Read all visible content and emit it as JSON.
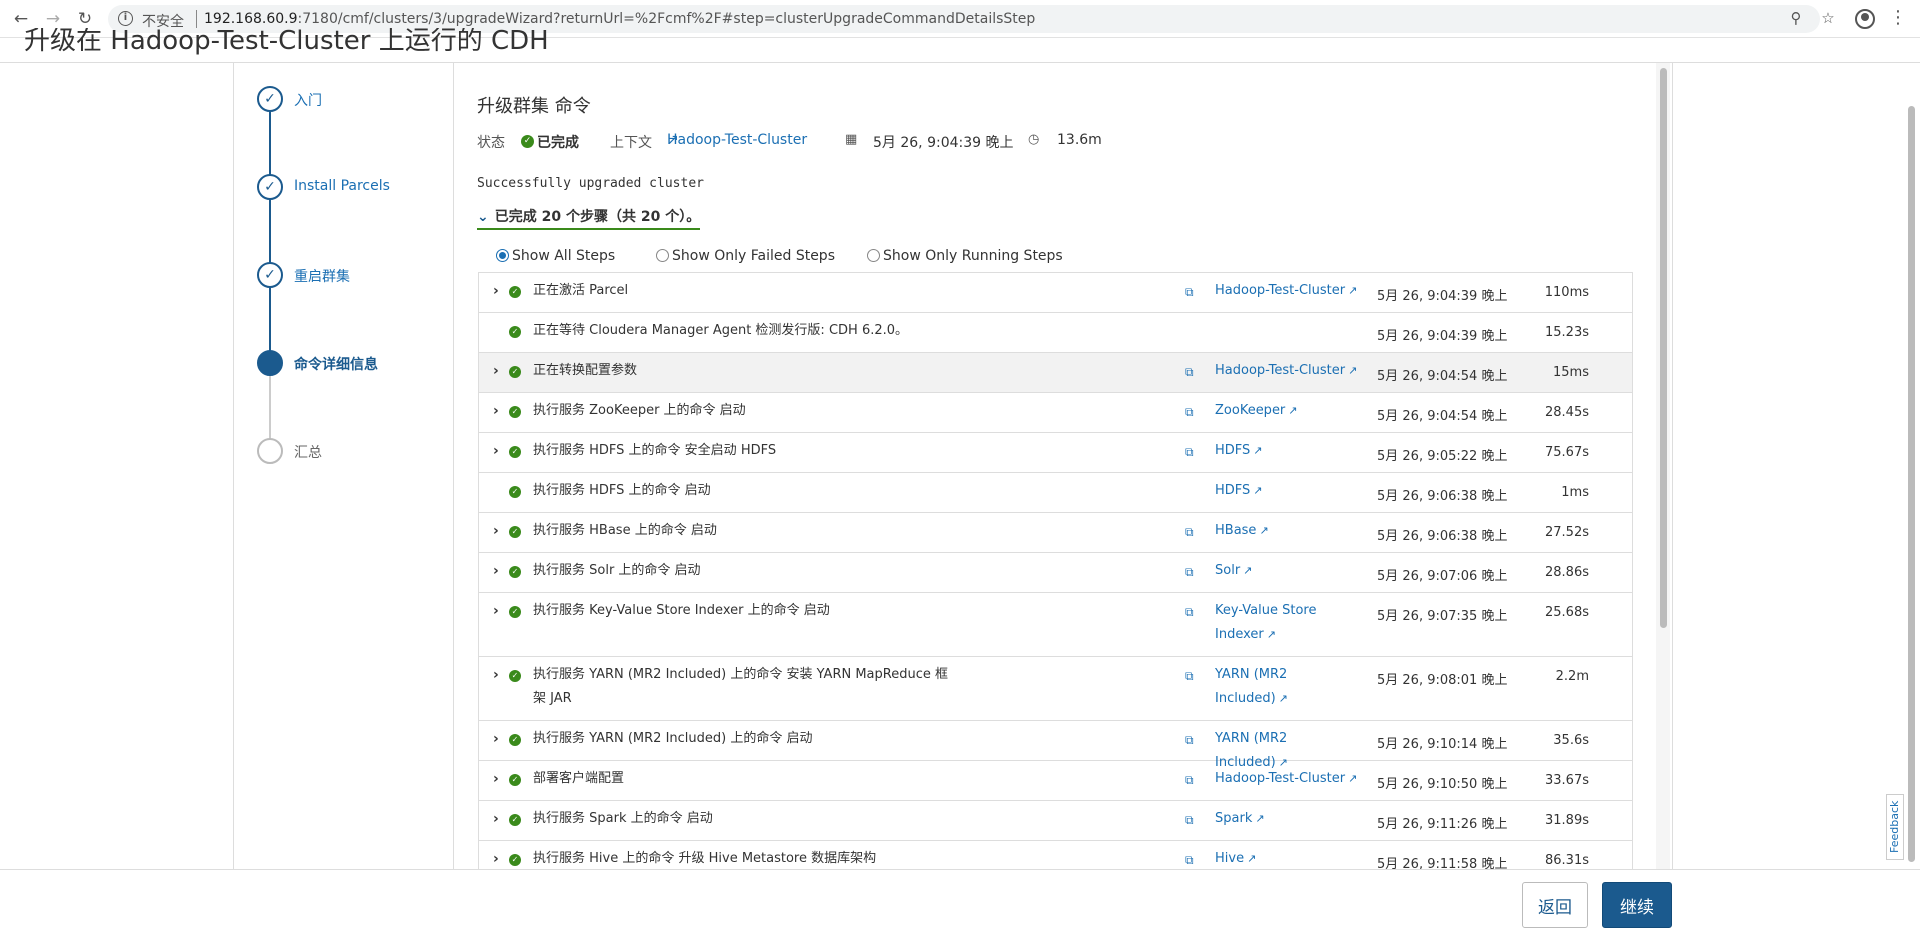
{
  "browser": {
    "insecure_label": "不安全",
    "url_host": "192.168.60.9",
    "url_path": ":7180/cmf/clusters/3/upgradeWizard?returnUrl=%2Fcmf%2F#step=clusterUpgradeCommandDetailsStep"
  },
  "page": {
    "title": "升级在 Hadoop-Test-Cluster 上运行的 CDH"
  },
  "wizard": {
    "steps": [
      {
        "label": "入门",
        "state": "done"
      },
      {
        "label": "Install Parcels",
        "state": "done"
      },
      {
        "label": "重启群集",
        "state": "done"
      },
      {
        "label": "命令详细信息",
        "state": "active"
      },
      {
        "label": "汇总",
        "state": "pending"
      }
    ]
  },
  "command": {
    "title": "升级群集 命令",
    "status_label": "状态",
    "status_value": "已完成",
    "context_label": "上下文",
    "context_value": "Hadoop-Test-Cluster",
    "start_time": "5月 26, 9:04:39 晚上",
    "duration": "13.6m",
    "result_message": "Successfully upgraded cluster",
    "steps_summary": "已完成 20 个步骤（共 20 个）。"
  },
  "filters": {
    "all": "Show All Steps",
    "failed": "Show Only Failed Steps",
    "running": "Show Only Running Steps",
    "selected": "all"
  },
  "steps": [
    {
      "name": "正在激活 Parcel",
      "ctx": "Hadoop-Test-Cluster",
      "time": "5月 26, 9:04:39 晚上",
      "dur": "110ms",
      "expandable": true
    },
    {
      "name": "正在等待 Cloudera Manager Agent 检测发行版: CDH 6.2.0。",
      "ctx": "",
      "time": "5月 26, 9:04:39 晚上",
      "dur": "15.23s",
      "expandable": false
    },
    {
      "name": "正在转换配置参数",
      "ctx": "Hadoop-Test-Cluster",
      "time": "5月 26, 9:04:54 晚上",
      "dur": "15ms",
      "expandable": true
    },
    {
      "name": "执行服务 ZooKeeper 上的命令 启动",
      "ctx": "ZooKeeper",
      "time": "5月 26, 9:04:54 晚上",
      "dur": "28.45s",
      "expandable": true
    },
    {
      "name": "执行服务 HDFS 上的命令 安全启动 HDFS",
      "ctx": "HDFS",
      "time": "5月 26, 9:05:22 晚上",
      "dur": "75.67s",
      "expandable": true
    },
    {
      "name": "执行服务 HDFS 上的命令 启动",
      "ctx": "HDFS",
      "time": "5月 26, 9:06:38 晚上",
      "dur": "1ms",
      "expandable": false
    },
    {
      "name": "执行服务 HBase 上的命令 启动",
      "ctx": "HBase",
      "time": "5月 26, 9:06:38 晚上",
      "dur": "27.52s",
      "expandable": true
    },
    {
      "name": "执行服务 Solr 上的命令 启动",
      "ctx": "Solr",
      "time": "5月 26, 9:07:06 晚上",
      "dur": "28.86s",
      "expandable": true
    },
    {
      "name": "执行服务 Key-Value Store Indexer 上的命令 启动",
      "ctx": "Key-Value Store Indexer",
      "time": "5月 26, 9:07:35 晚上",
      "dur": "25.68s",
      "expandable": true
    },
    {
      "name": "执行服务 YARN (MR2 Included) 上的命令 安装 YARN MapReduce 框架 JAR",
      "ctx": "YARN (MR2 Included)",
      "time": "5月 26, 9:08:01 晚上",
      "dur": "2.2m",
      "expandable": true
    },
    {
      "name": "执行服务 YARN (MR2 Included) 上的命令 启动",
      "ctx": "YARN (MR2 Included)",
      "time": "5月 26, 9:10:14 晚上",
      "dur": "35.6s",
      "expandable": true
    },
    {
      "name": "部署客户端配置",
      "ctx": "Hadoop-Test-Cluster",
      "time": "5月 26, 9:10:50 晚上",
      "dur": "33.67s",
      "expandable": true
    },
    {
      "name": "执行服务 Spark 上的命令 启动",
      "ctx": "Spark",
      "time": "5月 26, 9:11:26 晚上",
      "dur": "31.89s",
      "expandable": true
    },
    {
      "name": "执行服务 Hive 上的命令 升级 Hive Metastore 数据库架构",
      "ctx": "Hive",
      "time": "5月 26, 9:11:58 晚上",
      "dur": "86.31s",
      "expandable": true
    }
  ],
  "footer": {
    "back_label": "返回",
    "next_label": "继续",
    "feedback_label": "Feedback"
  }
}
